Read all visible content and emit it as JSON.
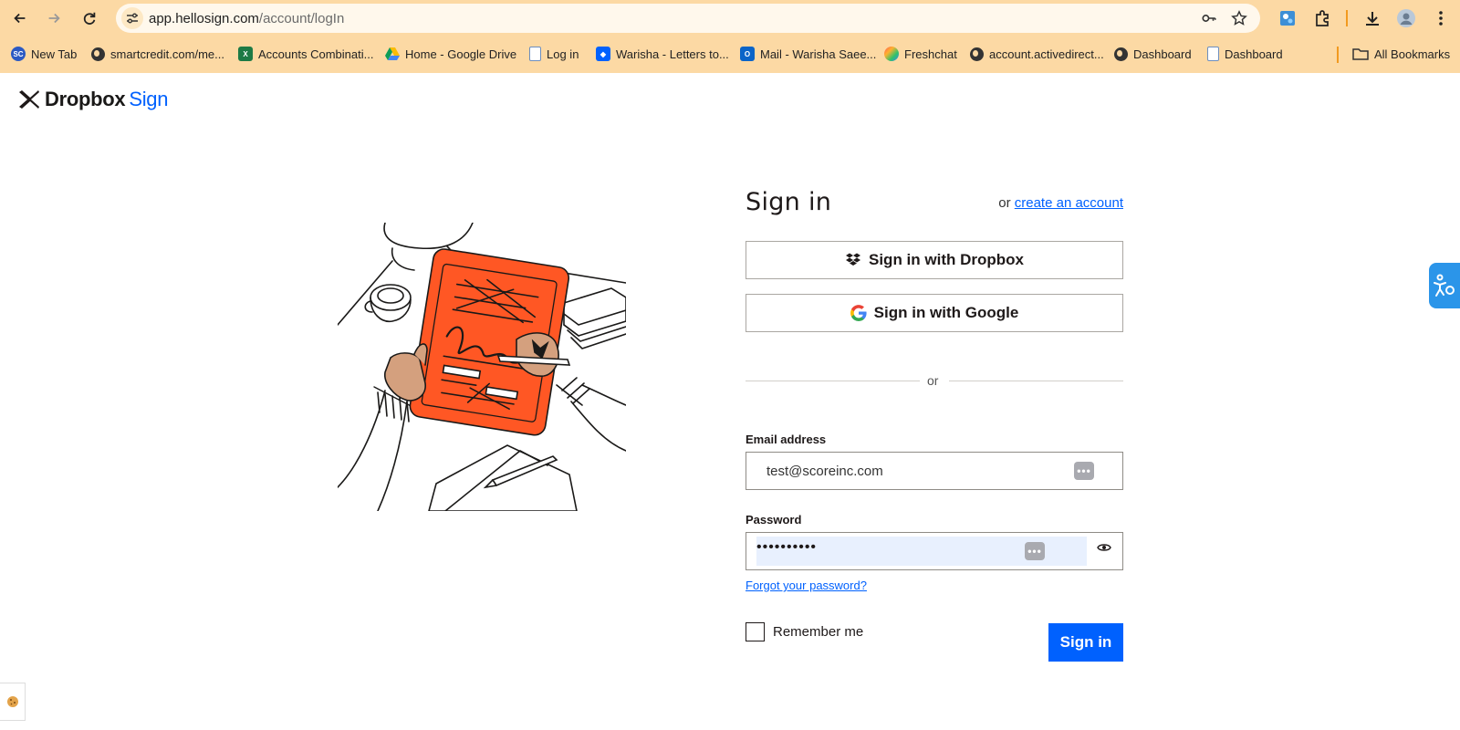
{
  "browser": {
    "url_host": "app.hellosign.com",
    "url_path": "/account/logIn",
    "bookmarks": [
      {
        "label": "New Tab",
        "icon": "sc-icon"
      },
      {
        "label": "smartcredit.com/me...",
        "icon": "globe-icon"
      },
      {
        "label": "Accounts Combinati...",
        "icon": "excel-icon"
      },
      {
        "label": "Home - Google Drive",
        "icon": "google-drive-icon"
      },
      {
        "label": "Log in",
        "icon": "document-icon"
      },
      {
        "label": "Warisha - Letters to...",
        "icon": "dropbox-icon"
      },
      {
        "label": "Mail - Warisha Saee...",
        "icon": "outlook-icon"
      },
      {
        "label": "Freshchat",
        "icon": "freshchat-icon"
      },
      {
        "label": "account.activedirect...",
        "icon": "globe-icon"
      },
      {
        "label": "Dashboard",
        "icon": "globe-icon"
      },
      {
        "label": "Dashboard",
        "icon": "document-icon"
      }
    ],
    "all_bookmarks_label": "All Bookmarks"
  },
  "brand": {
    "name": "Dropbox",
    "product": "Sign",
    "accent": "#0061fe"
  },
  "signin": {
    "title": "Sign in",
    "or_text": "or",
    "create_account_link": "create an account",
    "dropbox_button": "Sign in with Dropbox",
    "google_button": "Sign in with Google",
    "divider_text": "or",
    "email_label": "Email address",
    "email_value": "test@scoreinc.com",
    "password_label": "Password",
    "password_value": "••••••••••",
    "forgot_link": "Forgot your password?",
    "remember_label": "Remember me",
    "submit_button": "Sign in"
  },
  "colors": {
    "chrome_bg": "#fcd9a4",
    "illustration_orange": "#ff5724",
    "skin": "#d4a07e"
  }
}
